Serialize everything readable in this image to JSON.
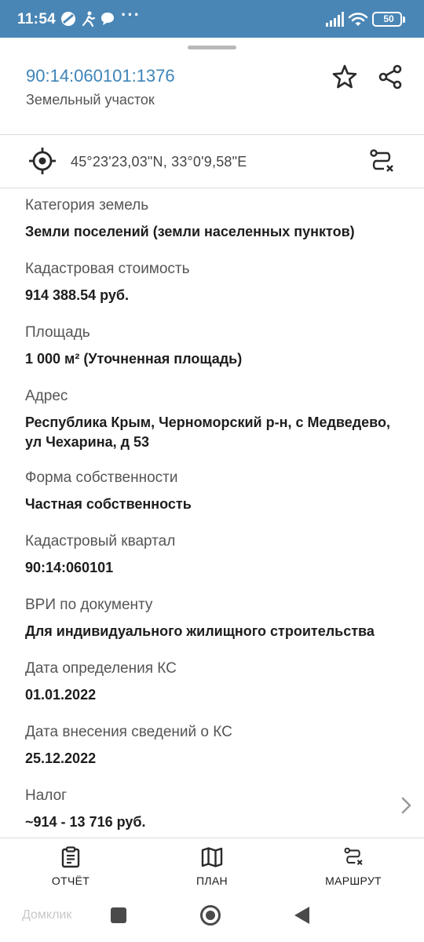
{
  "status_bar": {
    "time": "11:54",
    "dots": "···",
    "battery": "50"
  },
  "header": {
    "cadastral_number": "90:14:060101:1376",
    "object_type": "Земельный участок",
    "favorite_icon": "star-outline-icon",
    "share_icon": "share-icon"
  },
  "location": {
    "coordinates": "45°23'23,03\"N, 33°0'9,58\"E",
    "locate_icon": "crosshair-icon",
    "route_icon": "route-icon"
  },
  "attributes": [
    {
      "label": "Категория земель",
      "value": "Земли поселений (земли населенных пунктов)"
    },
    {
      "label": "Кадастровая стоимость",
      "value": "914 388.54 руб."
    },
    {
      "label": "Площадь",
      "value": "1 000 м² (Уточненная площадь)"
    },
    {
      "label": "Адрес",
      "value": "Республика Крым, Черноморский р-н, с Медведево, ул Чехарина, д 53"
    },
    {
      "label": "Форма собственности",
      "value": "Частная собственность"
    },
    {
      "label": "Кадастровый квартал",
      "value": "90:14:060101"
    },
    {
      "label": "ВРИ по документу",
      "value": "Для индивидуального жилищного строительства"
    },
    {
      "label": "Дата определения КС",
      "value": "01.01.2022"
    },
    {
      "label": "Дата внесения сведений о КС",
      "value": "25.12.2022"
    },
    {
      "label": "Налог",
      "value": "~914 - 13 716 руб."
    }
  ],
  "bottom_bar": {
    "report_label": "ОТЧЁТ",
    "plan_label": "ПЛАН",
    "route_label": "МАРШРУТ"
  },
  "nav_bar": {
    "watermark": "Домклик"
  },
  "colors": {
    "status_bar": "#4a86b5",
    "accent_link": "#3d84b8",
    "text_primary": "#1d1d1d",
    "text_secondary": "#555555"
  }
}
